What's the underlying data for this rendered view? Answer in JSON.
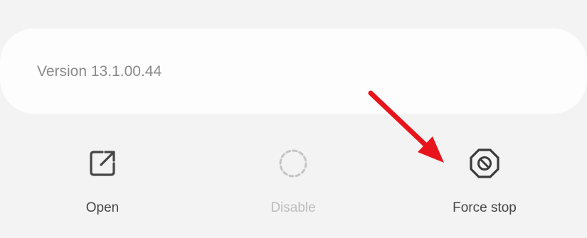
{
  "app_info": {
    "version_text": "Version 13.1.00.44"
  },
  "actions": [
    {
      "label": "Open",
      "icon": "open-external-icon",
      "enabled": true
    },
    {
      "label": "Disable",
      "icon": "disable-dashed-circle-icon",
      "enabled": false
    },
    {
      "label": "Force stop",
      "icon": "force-stop-octagon-icon",
      "enabled": true
    }
  ],
  "annotation": {
    "arrow_color": "#e8141b",
    "points_to": "Force stop"
  },
  "colors": {
    "background": "#f3f3f3",
    "card": "#fdfdfd",
    "label": "#454545",
    "disabled": "#bdbdbd",
    "version_text": "#8a8a8a"
  }
}
